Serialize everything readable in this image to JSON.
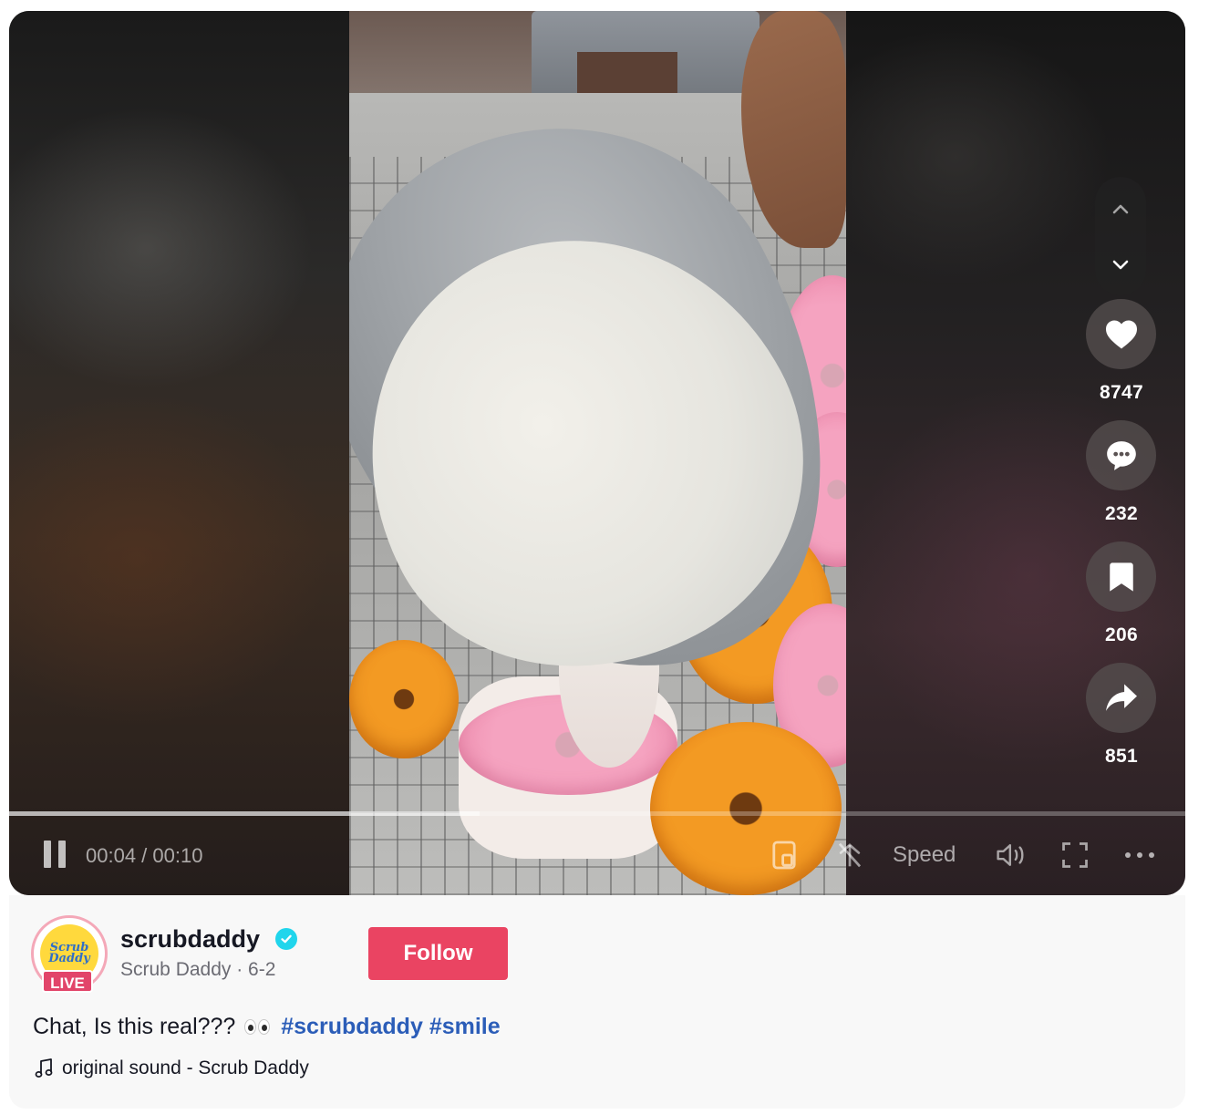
{
  "video": {
    "current_time": "00:04",
    "duration": "00:10",
    "time_display": "00:04 / 00:10",
    "progress": 0.4,
    "speed_label": "Speed"
  },
  "actions": {
    "likes": "8747",
    "comments": "232",
    "bookmarks": "206",
    "shares": "851"
  },
  "icons": {
    "nav_up": "chevron-up-icon",
    "nav_down": "chevron-down-icon",
    "like": "heart-icon",
    "comment": "comment-bubble-icon",
    "bookmark": "bookmark-icon",
    "share": "share-arrow-icon",
    "pause": "pause-icon",
    "pip": "picture-in-picture-icon",
    "autoscroll": "autoscroll-icon",
    "volume": "volume-icon",
    "fullscreen": "fullscreen-icon",
    "more": "more-dots-icon",
    "music": "music-note-icon",
    "verified": "verified-badge-icon"
  },
  "author": {
    "username": "scrubdaddy",
    "display_name": "Scrub Daddy",
    "date": "6-2",
    "subline": "Scrub Daddy · 6-2",
    "live_label": "LIVE",
    "avatar_text": "Scrub Daddy",
    "follow_label": "Follow"
  },
  "caption": {
    "text": "Chat, Is this real???",
    "emoji": "eyes-emoji",
    "hashtags": [
      "#scrubdaddy",
      "#smile"
    ]
  },
  "music": {
    "label": "original sound - Scrub Daddy"
  },
  "colors": {
    "follow": "#ea4462",
    "hashtag": "#2b5db8",
    "live": "#e2456a",
    "verified": "#20d5ec"
  }
}
